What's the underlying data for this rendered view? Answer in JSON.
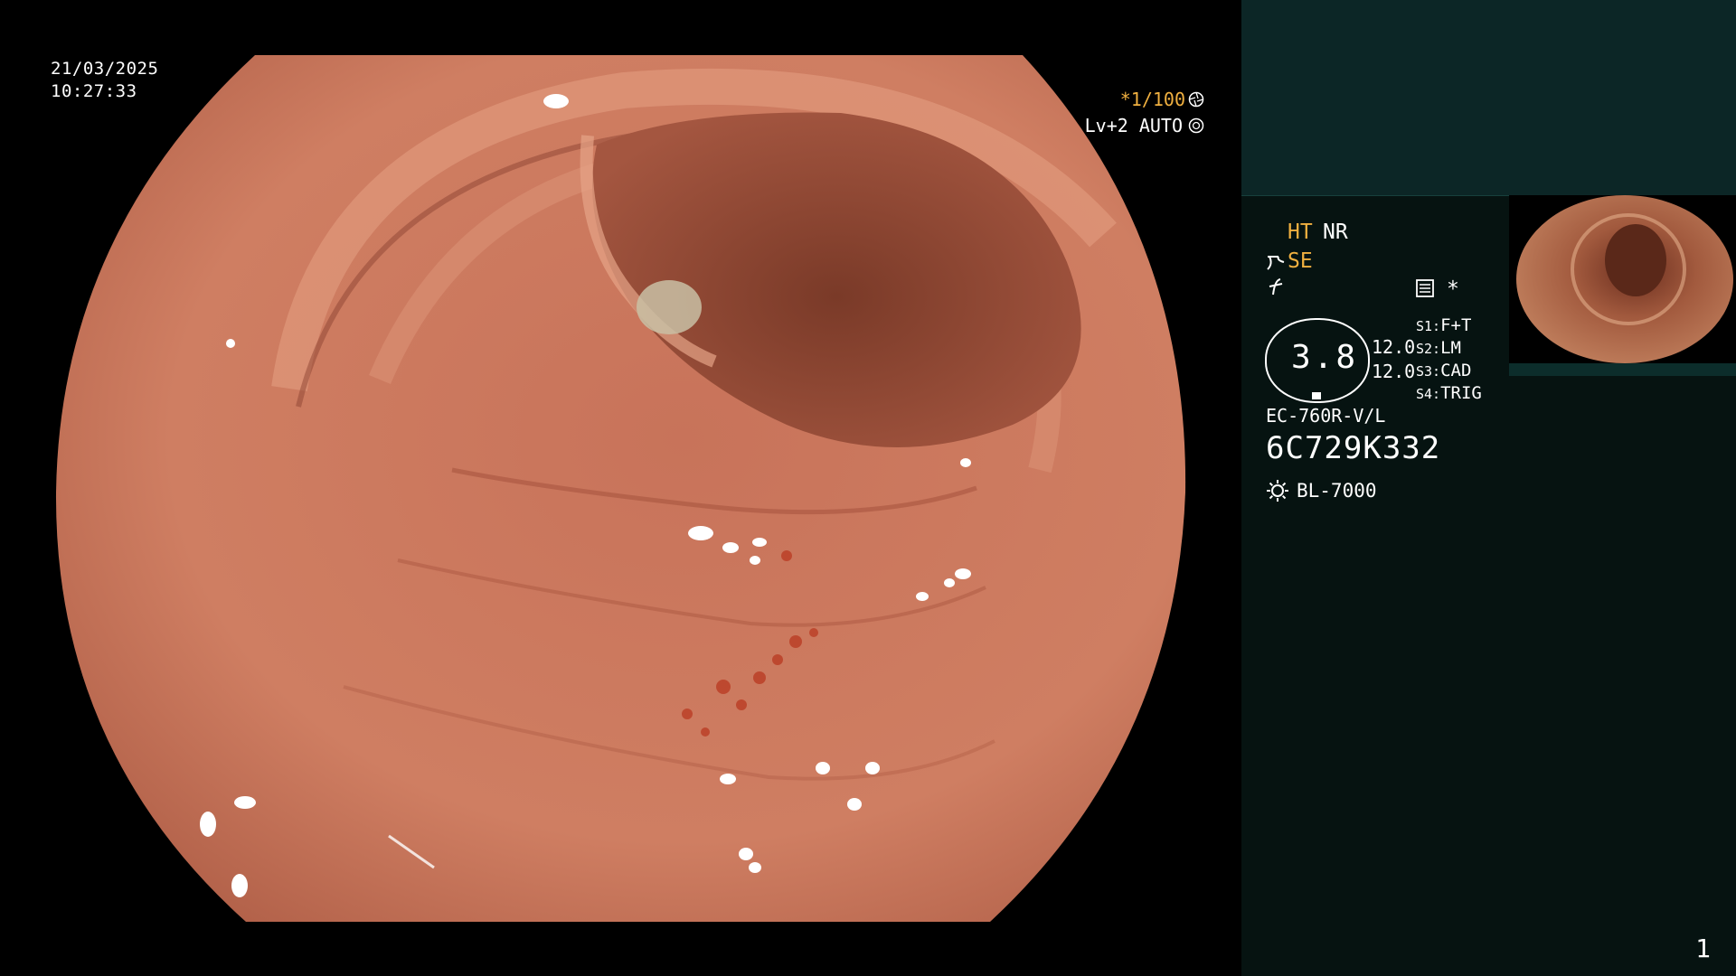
{
  "overlay": {
    "date": "21/03/2025",
    "time": "10:27:33",
    "shutter_speed": "*1/100",
    "shutter_icon": "aperture-icon",
    "iris_mode": "Lv+2 AUTO",
    "iris_icon": "iris-icon"
  },
  "panel": {
    "ht_label": "HT",
    "nr_label": "NR",
    "se_label": "SE",
    "se_icon": "structure-enhancement-icon",
    "color_icon": "color-mode-icon",
    "record_icon": "record-icon",
    "asterisk": "*",
    "zoom_value": "3.8",
    "value_1": "12.0",
    "value_2": "12.0",
    "switches": [
      {
        "key": "S1:",
        "value": "F+T"
      },
      {
        "key": "S2:",
        "value": "LM"
      },
      {
        "key": "S3:",
        "value": "CAD"
      },
      {
        "key": "S4:",
        "value": "TRIG"
      }
    ],
    "scope_model": "EC-760R-V/L",
    "scope_serial": "6C729K332",
    "light_source_icon": "light-bulb-icon",
    "light_source": "BL-7000",
    "page_number": "1"
  },
  "colors": {
    "accent_amber": "#f0b040",
    "panel_bg": "#061311",
    "panel_top_bg": "#0c2626"
  }
}
